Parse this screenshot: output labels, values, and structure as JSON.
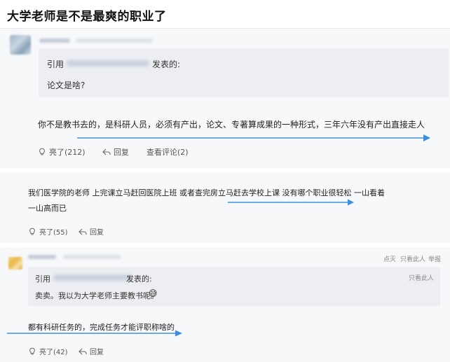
{
  "header": {
    "title": "大学老师是不是最爽的职业了"
  },
  "post1": {
    "quote_prefix": "引用",
    "quote_suffix": "发表的:",
    "quote_text": "论文是啥?",
    "body": "你不是教书去的，是科研人员，必须有产出，论文、专著算成果的一种形式，三年六年没有产出直接走人",
    "like_label": "亮了(212)",
    "reply_label": "回复",
    "comments_label": "查看评论(2)"
  },
  "post2": {
    "body_line1": "我们医学院的老师  上完课立马赶回医院上班  或者查完房立马赶去学校上课  没有哪个职业很轻松  一山看着",
    "body_line2": "一山高而已",
    "like_label": "亮了(55)",
    "reply_label": "回复"
  },
  "post3": {
    "meta_actions": [
      "点灭",
      "只看此人",
      "举报"
    ],
    "quote_prefix": "引用",
    "quote_suffix": "发表的:",
    "quote_meta": "只看此人",
    "quote_text": "卖卖。我以为大学老师主要教书呢。",
    "emoji": "😅",
    "body": "都有科研任务的，完成任务才能评职称啥的",
    "like_label": "亮了(42)",
    "reply_label": "回复"
  },
  "colors": {
    "arrow": "#3b8fe0",
    "card_bg": "#f7f8fa",
    "quote_bg": "#eceef2"
  }
}
